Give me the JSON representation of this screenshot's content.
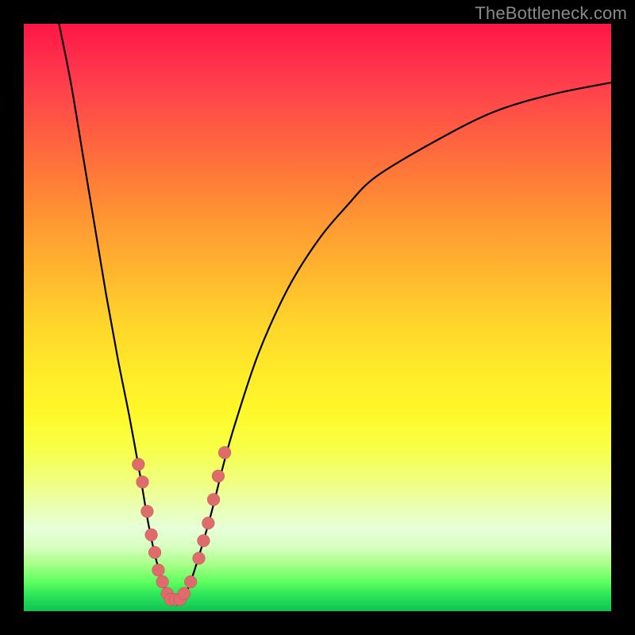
{
  "watermark": "TheBottleneck.com",
  "colors": {
    "background": "#000000",
    "curve": "#000000",
    "dot": "#e06b6b"
  },
  "chart_data": {
    "type": "line",
    "title": "",
    "xlabel": "",
    "ylabel": "",
    "xlim": [
      0,
      100
    ],
    "ylim": [
      0,
      100
    ],
    "grid": false,
    "legend": false,
    "annotations": [],
    "series": [
      {
        "name": "curve-left",
        "x": [
          6,
          8,
          10,
          12,
          14,
          16,
          18,
          20,
          21,
          22,
          23,
          24,
          25,
          26
        ],
        "y": [
          100,
          90,
          78,
          66,
          54,
          43,
          33,
          22,
          16,
          11,
          7,
          4,
          2,
          1
        ]
      },
      {
        "name": "curve-right",
        "x": [
          26,
          28,
          30,
          32,
          34,
          36,
          40,
          45,
          50,
          55,
          60,
          70,
          80,
          90,
          100
        ],
        "y": [
          1,
          4,
          10,
          17,
          25,
          32,
          44,
          55,
          63,
          69,
          74,
          80,
          85,
          88,
          90
        ]
      }
    ],
    "dots": {
      "name": "highlight-dots",
      "x": [
        19.5,
        20.2,
        21.0,
        21.7,
        22.3,
        22.9,
        23.6,
        24.4,
        25.0,
        25.8,
        26.6,
        27.3,
        28.4,
        29.8,
        30.6,
        31.4,
        32.3,
        33.1,
        34.2
      ],
      "y": [
        25,
        22,
        17,
        13,
        10,
        7,
        5,
        3,
        2,
        2,
        2,
        3,
        5,
        9,
        12,
        15,
        19,
        23,
        27
      ]
    }
  }
}
